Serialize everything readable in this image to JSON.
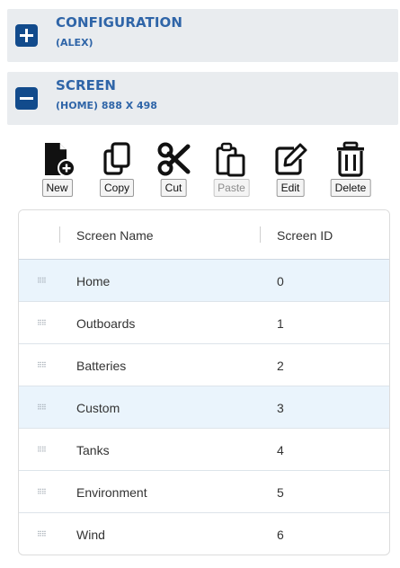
{
  "configuration": {
    "toggle": "+",
    "title": "CONFIGURATION",
    "subtitle": "(ALEX)"
  },
  "screen": {
    "toggle": "−",
    "title": "SCREEN",
    "subtitle": "(HOME) 888 X 498"
  },
  "toolbar": {
    "new": {
      "label": "New",
      "icon": "new-file-icon"
    },
    "copy": {
      "label": "Copy",
      "icon": "copy-icon"
    },
    "cut": {
      "label": "Cut",
      "icon": "scissors-icon"
    },
    "paste": {
      "label": "Paste",
      "icon": "paste-icon",
      "disabled": true
    },
    "edit": {
      "label": "Edit",
      "icon": "edit-icon"
    },
    "delete": {
      "label": "Delete",
      "icon": "trash-icon"
    }
  },
  "grid": {
    "columns": [
      "Screen Name",
      "Screen ID"
    ],
    "rows": [
      {
        "name": "Home",
        "id": "0",
        "highlighted": true
      },
      {
        "name": "Outboards",
        "id": "1",
        "highlighted": false
      },
      {
        "name": "Batteries",
        "id": "2",
        "highlighted": false
      },
      {
        "name": "Custom",
        "id": "3",
        "highlighted": true
      },
      {
        "name": "Tanks",
        "id": "4",
        "highlighted": false
      },
      {
        "name": "Environment",
        "id": "5",
        "highlighted": false
      },
      {
        "name": "Wind",
        "id": "6",
        "highlighted": false
      }
    ]
  },
  "colors": {
    "accent": "#124b8c",
    "title": "#2f65a8",
    "header_bg": "#e9ecef",
    "row_highlight": "#eaf4fc"
  }
}
